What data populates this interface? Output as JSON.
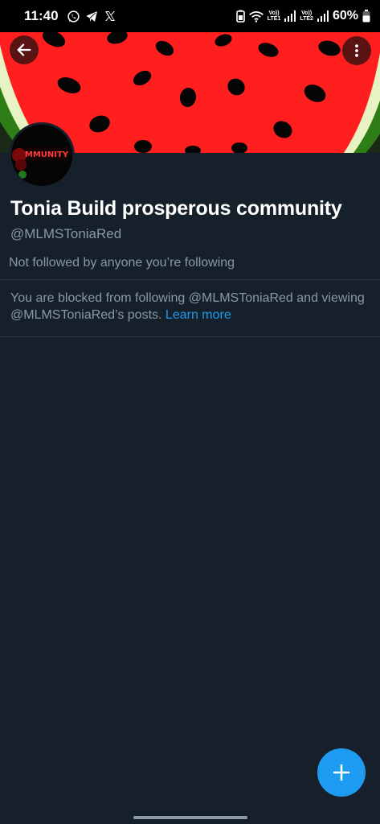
{
  "status_bar": {
    "time": "11:40",
    "left_icons": [
      "whatsapp-icon",
      "telegram-icon",
      "x-icon"
    ],
    "right_icons": [
      "battery-saver-icon",
      "wifi-icon",
      "signal-icon",
      "signal-icon"
    ],
    "sim1_label_top": "Vo))",
    "sim1_label_bottom": "LTE1",
    "sim2_label_top": "Vo))",
    "sim2_label_bottom": "LTE2",
    "battery_text": "60%",
    "battery_level": 0.6
  },
  "header": {
    "back_icon": "arrow-left-icon",
    "more_icon": "more-vertical-icon"
  },
  "colors": {
    "background": "#15202b",
    "accent": "#1d9bf0",
    "muted_text": "#8b98a5",
    "banner_red": "#ff1f1f",
    "banner_green": "#3b8a1e"
  },
  "avatar": {
    "text": "MMUNITY"
  },
  "profile": {
    "display_name": "Tonia Build prosperous community",
    "handle": "@MLMSToniaRed",
    "followed_by": "Not followed by anyone you’re following"
  },
  "blocked_notice": {
    "text": "You are blocked from following @MLMSToniaRed and viewing @MLMSToniaRed’s posts.",
    "link_label": "Learn more"
  },
  "fab": {
    "icon": "plus-icon"
  }
}
